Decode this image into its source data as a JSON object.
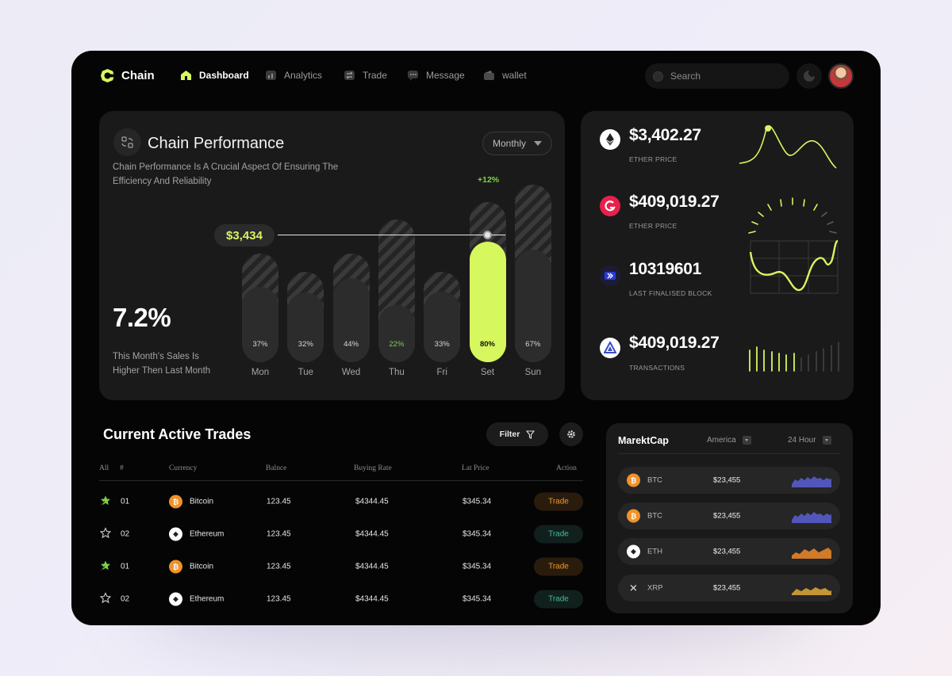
{
  "nav": {
    "logo": "Chain",
    "items": [
      {
        "label": "Dashboard",
        "icon": "home-icon",
        "active": true
      },
      {
        "label": "Analytics",
        "icon": "analytics-icon",
        "active": false
      },
      {
        "label": "Trade",
        "icon": "swap-icon",
        "active": false
      },
      {
        "label": "Message",
        "icon": "message-icon",
        "active": false
      },
      {
        "label": "wallet",
        "icon": "wallet-icon",
        "active": false
      }
    ],
    "search_placeholder": "Search",
    "accent": "#d7f75f"
  },
  "performance": {
    "title": "Chain Performance",
    "description": "Chain Performance Is A Crucial Aspect Of Ensuring The Efficiency And Reliability",
    "period": "Monthly",
    "percent": "7.2%",
    "subtitle": "This Month's Sales Is Higher Then Last Month",
    "value_tag": "$3,434",
    "change_tag": "+12%"
  },
  "chart_data": {
    "type": "bar",
    "categories": [
      "Mon",
      "Tue",
      "Wed",
      "Thu",
      "Fri",
      "Set",
      "Sun"
    ],
    "values": [
      37,
      32,
      44,
      22,
      33,
      80,
      67
    ],
    "labels": [
      "37%",
      "32%",
      "44%",
      "22%",
      "33%",
      "80%",
      "67%"
    ],
    "highlight_index": 5,
    "highlight_color": "#d7f75f"
  },
  "stats": [
    {
      "value": "$3,402.27",
      "label": "ETHER PRICE",
      "icon": "ethereum-icon"
    },
    {
      "value": "$409,019.27",
      "label": "ETHER PRICE",
      "icon": "gemini-icon"
    },
    {
      "value": "10319601",
      "label": "LAST FINALISED BLOCK",
      "icon": "block-icon"
    },
    {
      "value": "$409,019.27",
      "label": "TRANSACTIONS",
      "icon": "alchemy-icon"
    }
  ],
  "trades": {
    "title": "Current Active Trades",
    "filter_label": "Filter",
    "headers": [
      "All",
      "#",
      "Currency",
      "Balnce",
      "Buying Rate",
      "Lat Price",
      "Action"
    ],
    "rows": [
      {
        "starred": true,
        "num": "01",
        "currency": "Bitcoin",
        "coin": "btc",
        "balance": "123.45",
        "rate": "$4344.45",
        "price": "$345.34",
        "action": "Trade"
      },
      {
        "starred": false,
        "num": "02",
        "currency": "Ethereum",
        "coin": "eth",
        "balance": "123.45",
        "rate": "$4344.45",
        "price": "$345.34",
        "action": "Trade"
      },
      {
        "starred": true,
        "num": "01",
        "currency": "Bitcoin",
        "coin": "btc",
        "balance": "123.45",
        "rate": "$4344.45",
        "price": "$345.34",
        "action": "Trade"
      },
      {
        "starred": false,
        "num": "02",
        "currency": "Ethereum",
        "coin": "eth",
        "balance": "123.45",
        "rate": "$4344.45",
        "price": "$345.34",
        "action": "Trade"
      }
    ]
  },
  "marketcap": {
    "title": "MarektCap",
    "region": "America",
    "range": "24 Hour",
    "rows": [
      {
        "symbol": "BTC",
        "price": "$23,455",
        "coin": "btc",
        "color": "#5b5fd6"
      },
      {
        "symbol": "BTC",
        "price": "$23,455",
        "coin": "btc",
        "color": "#5b5fd6"
      },
      {
        "symbol": "ETH",
        "price": "$23,455",
        "coin": "eth",
        "color": "#f08a2a"
      },
      {
        "symbol": "XRP",
        "price": "$23,455",
        "coin": "xrp",
        "color": "#e0a83a"
      }
    ]
  }
}
